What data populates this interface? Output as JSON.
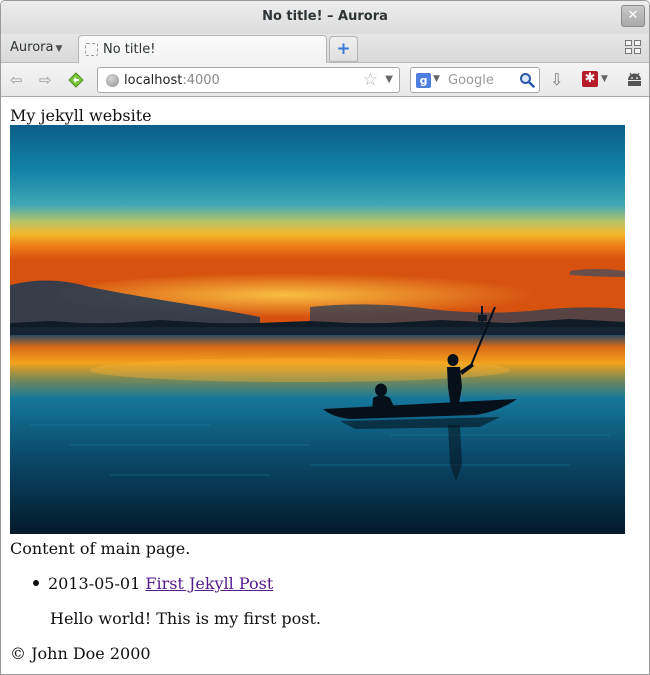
{
  "window": {
    "title": "No title! – Aurora",
    "close_glyph": "✕"
  },
  "tabbar": {
    "app_menu_label": "Aurora",
    "tabs": [
      {
        "label": "No title!"
      }
    ],
    "new_tab_glyph": "+"
  },
  "navbar": {
    "back_icon": "back-arrow-icon",
    "forward_icon": "forward-arrow-icon",
    "url": {
      "host": "localhost",
      "port": ":4000"
    },
    "search": {
      "placeholder": "Google"
    }
  },
  "page": {
    "site_title": "My jekyll website",
    "hero_image_alt": "sunset-boat-photo",
    "main_text": "Content of main page.",
    "posts": [
      {
        "date": "2013-05-01",
        "title": "First Jekyll Post",
        "excerpt": "Hello world! This is my first post."
      }
    ],
    "footer": "© John Doe 2000"
  },
  "colors": {
    "link_visited": "#551a8b",
    "new_tab_accent": "#3a7bd5",
    "addon_red": "#b71c2a"
  }
}
